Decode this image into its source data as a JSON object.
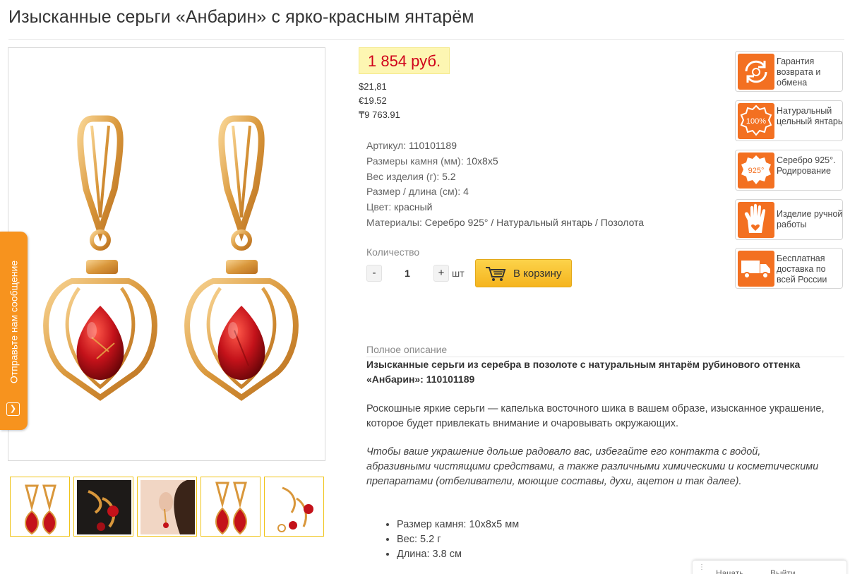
{
  "page": {
    "title": "Изысканные серьги «Анбарин» с ярко-красным янтарём"
  },
  "side_tab": {
    "label": "Отправьте нам сообщение"
  },
  "price": {
    "main": "1 854 руб.",
    "usd": "$21,81",
    "eur": "€19.52",
    "kzt": "₸9 763.91"
  },
  "specs": [
    {
      "label": "Артикул:",
      "value": "110101189"
    },
    {
      "label": "Размеры камня (мм):",
      "value": "10x8x5"
    },
    {
      "label": "Вес изделия (г):",
      "value": "5.2"
    },
    {
      "label": "Размер / длина (см):",
      "value": "4"
    },
    {
      "label": "Цвет:",
      "value": "красный"
    },
    {
      "label": "Материалы:",
      "value": "Серебро 925° / Натуральный янтарь / Позолота"
    }
  ],
  "quantity": {
    "label": "Количество",
    "minus": "-",
    "plus": "+",
    "value": "1",
    "unit": "шт"
  },
  "cart": {
    "label": "В корзину"
  },
  "badges": [
    {
      "icon": "return-exchange-icon",
      "text": "Гарантия возврата и обмена"
    },
    {
      "icon": "natural-amber-100-icon",
      "badge_text": "100%",
      "text": "Натуральный цельный янтарь"
    },
    {
      "icon": "silver-925-icon",
      "badge_text": "925°",
      "text": "Серебро 925°. Родирование"
    },
    {
      "icon": "handmade-hand-icon",
      "text": "Изделие ручной работы"
    },
    {
      "icon": "delivery-truck-icon",
      "text": "Бесплатная доставка по всей России"
    }
  ],
  "description": {
    "label": "Полное описание",
    "heading": "Изысканные серьги из серебра в позолоте с натуральным янтарём рубинового оттенка «Анбарин»: 110101189",
    "paragraph": "Роскошные яркие серьги — капелька восточного шика в вашем образе, изысканное украшение, которое будет привлекать внимание и очаровывать окружающих.",
    "care": "Чтобы ваше украшение дольше радовало вас, избегайте его контакта с водой, абразивными чистящими средствами, а также различными химическими и косметическими препаратами (отбеливатели, моющие составы, духи, ацетон и так далее).",
    "list": [
      "Размер камня: 10x8x5 мм",
      "Вес: 5.2 г",
      "Длина: 3.8 см"
    ]
  },
  "widget": {
    "tab1": "Начать",
    "tab2": "Выйти"
  },
  "colors": {
    "accent": "#f37021",
    "price": "#d0021b",
    "price_bg": "#fdf6b2",
    "cart": "#f5b41e",
    "thumb_border": "#f0c419"
  }
}
